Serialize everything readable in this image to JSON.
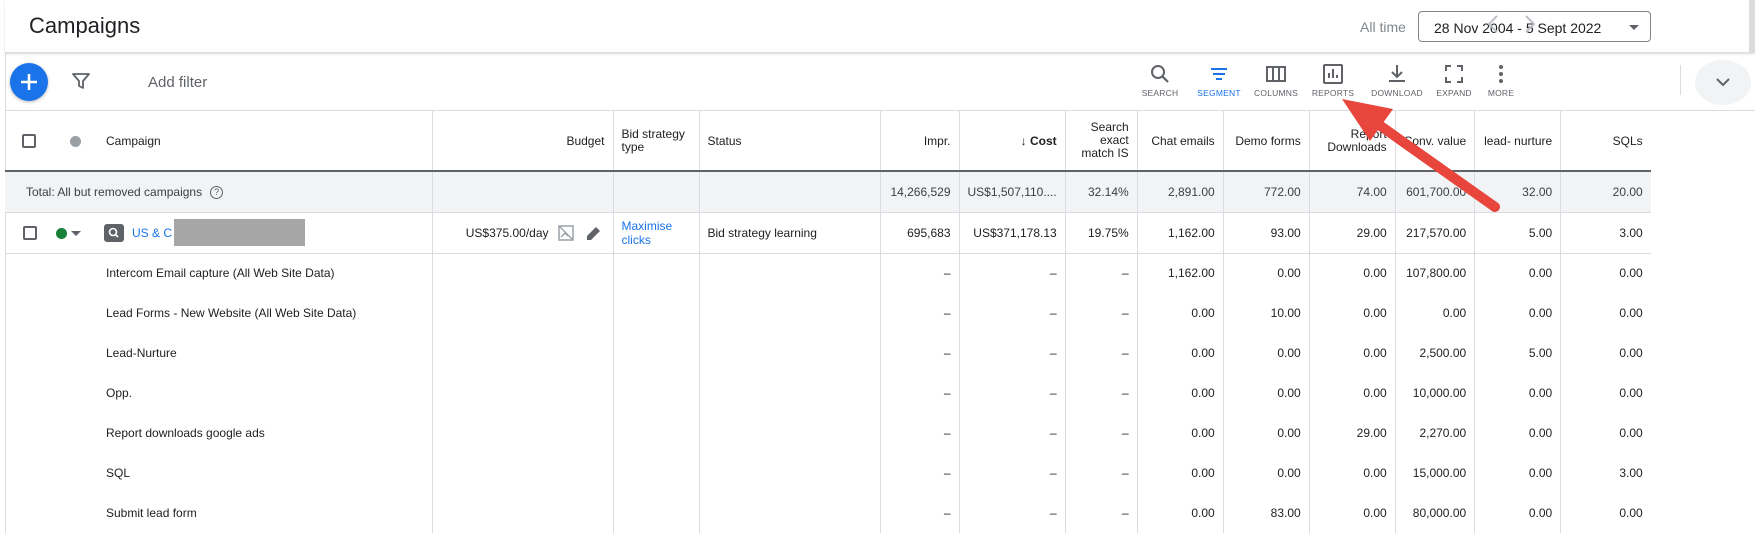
{
  "header": {
    "title": "Campaigns",
    "all_time_label": "All time",
    "date_range": "28 Nov 2004 - 5 Sept 2022",
    "prev_icon": "chevron-left-icon",
    "next_icon": "chevron-right-icon"
  },
  "toolbar": {
    "add_icon": "plus-icon",
    "filter_icon": "filter-icon",
    "add_filter_label": "Add filter",
    "tools": [
      {
        "label": "SEARCH",
        "icon": "search-icon"
      },
      {
        "label": "SEGMENT",
        "icon": "segment-icon",
        "active": true
      },
      {
        "label": "COLUMNS",
        "icon": "columns-icon"
      },
      {
        "label": "REPORTS",
        "icon": "reports-icon"
      },
      {
        "label": "DOWNLOAD",
        "icon": "download-icon"
      },
      {
        "label": "EXPAND",
        "icon": "expand-icon"
      },
      {
        "label": "MORE",
        "icon": "more-vert-icon"
      }
    ],
    "collapse_icon": "chevron-down-icon"
  },
  "table": {
    "headers": {
      "campaign": "Campaign",
      "budget": "Budget",
      "bid_strategy": "Bid strategy type",
      "status": "Status",
      "impr": "Impr.",
      "cost": "Cost",
      "search_exact": "Search exact match IS",
      "chat_emails": "Chat emails",
      "demo_forms": "Demo forms",
      "report_downloads": "Report Downloads",
      "conv_value": "Conv. value",
      "lead_nurture": "lead- nurture",
      "sqls": "SQLs"
    },
    "total_row": {
      "label": "Total: All but removed campaigns",
      "impr": "14,266,529",
      "cost": "US$1,507,110....",
      "search_exact": "32.14%",
      "chat_emails": "2,891.00",
      "demo_forms": "772.00",
      "report_downloads": "74.00",
      "conv_value": "601,700.00",
      "lead_nurture": "32.00",
      "sqls": "20.00"
    },
    "campaign_row": {
      "name": "US & C",
      "budget": "US$375.00/day",
      "bid_strategy": "Maximise clicks",
      "status": "Bid strategy learning",
      "impr": "695,683",
      "cost": "US$371,178.13",
      "search_exact": "19.75%",
      "chat_emails": "1,162.00",
      "demo_forms": "93.00",
      "report_downloads": "29.00",
      "conv_value": "217,570.00",
      "lead_nurture": "5.00",
      "sqls": "3.00"
    },
    "conversion_rows": [
      {
        "name": "Intercom Email capture (All Web Site Data)",
        "impr": "–",
        "cost": "–",
        "search_exact": "–",
        "chat_emails": "1,162.00",
        "demo_forms": "0.00",
        "report_downloads": "0.00",
        "conv_value": "107,800.00",
        "lead_nurture": "0.00",
        "sqls": "0.00"
      },
      {
        "name": "Lead Forms - New Website (All Web Site Data)",
        "impr": "–",
        "cost": "–",
        "search_exact": "–",
        "chat_emails": "0.00",
        "demo_forms": "10.00",
        "report_downloads": "0.00",
        "conv_value": "0.00",
        "lead_nurture": "0.00",
        "sqls": "0.00"
      },
      {
        "name": "Lead-Nurture",
        "impr": "–",
        "cost": "–",
        "search_exact": "–",
        "chat_emails": "0.00",
        "demo_forms": "0.00",
        "report_downloads": "0.00",
        "conv_value": "2,500.00",
        "lead_nurture": "5.00",
        "sqls": "0.00"
      },
      {
        "name": "Opp.",
        "impr": "–",
        "cost": "–",
        "search_exact": "–",
        "chat_emails": "0.00",
        "demo_forms": "0.00",
        "report_downloads": "0.00",
        "conv_value": "10,000.00",
        "lead_nurture": "0.00",
        "sqls": "0.00"
      },
      {
        "name": "Report downloads google ads",
        "impr": "–",
        "cost": "–",
        "search_exact": "–",
        "chat_emails": "0.00",
        "demo_forms": "0.00",
        "report_downloads": "29.00",
        "conv_value": "2,270.00",
        "lead_nurture": "0.00",
        "sqls": "0.00"
      },
      {
        "name": "SQL",
        "impr": "–",
        "cost": "–",
        "search_exact": "–",
        "chat_emails": "0.00",
        "demo_forms": "0.00",
        "report_downloads": "0.00",
        "conv_value": "15,000.00",
        "lead_nurture": "0.00",
        "sqls": "3.00"
      },
      {
        "name": "Submit lead form",
        "impr": "–",
        "cost": "–",
        "search_exact": "–",
        "chat_emails": "0.00",
        "demo_forms": "83.00",
        "report_downloads": "0.00",
        "conv_value": "80,000.00",
        "lead_nurture": "0.00",
        "sqls": "0.00"
      }
    ]
  },
  "colors": {
    "accent": "#1a73e8",
    "annotation_arrow": "#e8453c",
    "enabled_status": "#188038"
  }
}
